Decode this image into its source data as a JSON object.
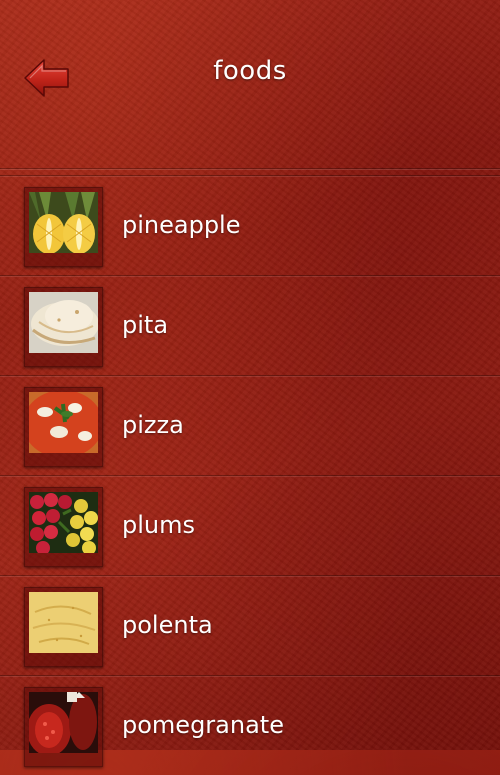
{
  "header": {
    "title": "foods",
    "back_icon": "back-arrow-icon",
    "accent_color": "#c0241a"
  },
  "list": {
    "items": [
      {
        "label": "pineapple",
        "image": "pineapple-image"
      },
      {
        "label": "pita",
        "image": "pita-image"
      },
      {
        "label": "pizza",
        "image": "pizza-image"
      },
      {
        "label": "plums",
        "image": "plums-image"
      },
      {
        "label": "polenta",
        "image": "polenta-image"
      },
      {
        "label": "pomegranate",
        "image": "pomegranate-image"
      }
    ]
  }
}
